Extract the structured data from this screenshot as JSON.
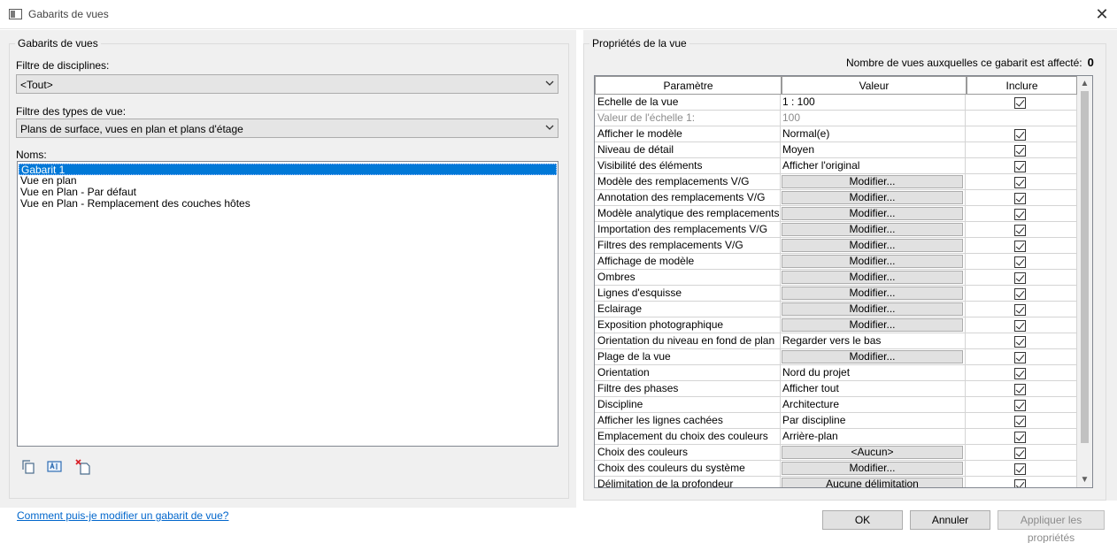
{
  "window": {
    "title": "Gabarits de vues",
    "close_glyph": "✕"
  },
  "left": {
    "group_title": "Gabarits de vues",
    "discipline_label": "Filtre de disciplines:",
    "discipline_value": "<Tout>",
    "viewtype_label": "Filtre des types de vue:",
    "viewtype_value": "Plans de surface, vues en plan et plans d'étage",
    "names_label": "Noms:",
    "names": [
      "Gabarit 1",
      "Vue en plan",
      "Vue en Plan - Par défaut",
      "Vue en Plan - Remplacement des couches hôtes"
    ],
    "selected_index": 0,
    "tools": [
      "duplicate-icon",
      "rename-icon",
      "delete-icon"
    ]
  },
  "help_link": "Comment puis-je modifier un gabarit de vue?",
  "right": {
    "group_title": "Propriétés de la vue",
    "count_label": "Nombre de vues auxquelles ce gabarit est affecté:",
    "count_value": "0",
    "headers": [
      "Paramètre",
      "Valeur",
      "Inclure"
    ],
    "rows": [
      {
        "param": "Echelle de la vue",
        "value": "1 : 100",
        "button": false,
        "checked": true
      },
      {
        "param": "Valeur de l'échelle    1:",
        "value": "100",
        "button": false,
        "checked": null,
        "disabled": true
      },
      {
        "param": "Afficher le modèle",
        "value": "Normal(e)",
        "button": false,
        "checked": true
      },
      {
        "param": "Niveau de détail",
        "value": "Moyen",
        "button": false,
        "checked": true
      },
      {
        "param": "Visibilité des éléments",
        "value": "Afficher l'original",
        "button": false,
        "checked": true
      },
      {
        "param": "Modèle des remplacements V/G",
        "value": "Modifier...",
        "button": true,
        "checked": true
      },
      {
        "param": "Annotation des remplacements V/G",
        "value": "Modifier...",
        "button": true,
        "checked": true
      },
      {
        "param": "Modèle analytique des remplacements",
        "value": "Modifier...",
        "button": true,
        "checked": true
      },
      {
        "param": "Importation des remplacements V/G",
        "value": "Modifier...",
        "button": true,
        "checked": true
      },
      {
        "param": "Filtres des remplacements V/G",
        "value": "Modifier...",
        "button": true,
        "checked": true
      },
      {
        "param": "Affichage de modèle",
        "value": "Modifier...",
        "button": true,
        "checked": true
      },
      {
        "param": "Ombres",
        "value": "Modifier...",
        "button": true,
        "checked": true
      },
      {
        "param": "Lignes d'esquisse",
        "value": "Modifier...",
        "button": true,
        "checked": true
      },
      {
        "param": "Eclairage",
        "value": "Modifier...",
        "button": true,
        "checked": true
      },
      {
        "param": "Exposition photographique",
        "value": "Modifier...",
        "button": true,
        "checked": true
      },
      {
        "param": "Orientation du niveau en fond de plan",
        "value": "Regarder vers le bas",
        "button": false,
        "checked": true
      },
      {
        "param": "Plage de la vue",
        "value": "Modifier...",
        "button": true,
        "checked": true
      },
      {
        "param": "Orientation",
        "value": "Nord du projet",
        "button": false,
        "checked": true
      },
      {
        "param": "Filtre des phases",
        "value": "Afficher tout",
        "button": false,
        "checked": true
      },
      {
        "param": "Discipline",
        "value": "Architecture",
        "button": false,
        "checked": true
      },
      {
        "param": "Afficher les lignes cachées",
        "value": "Par discipline",
        "button": false,
        "checked": true
      },
      {
        "param": "Emplacement du choix des couleurs",
        "value": "Arrière-plan",
        "button": false,
        "checked": true
      },
      {
        "param": "Choix des couleurs",
        "value": "<Aucun>",
        "button": true,
        "checked": true
      },
      {
        "param": "Choix des couleurs du système",
        "value": "Modifier...",
        "button": true,
        "checked": true
      },
      {
        "param": "Délimitation de la profondeur",
        "value": "Aucune délimitation",
        "button": true,
        "checked": true
      }
    ]
  },
  "buttons": {
    "ok": "OK",
    "cancel": "Annuler",
    "apply": "Appliquer les propriétés"
  },
  "colors": {
    "panel": "#f0f0f0",
    "selection": "#0078d7",
    "link": "#0066cc"
  }
}
